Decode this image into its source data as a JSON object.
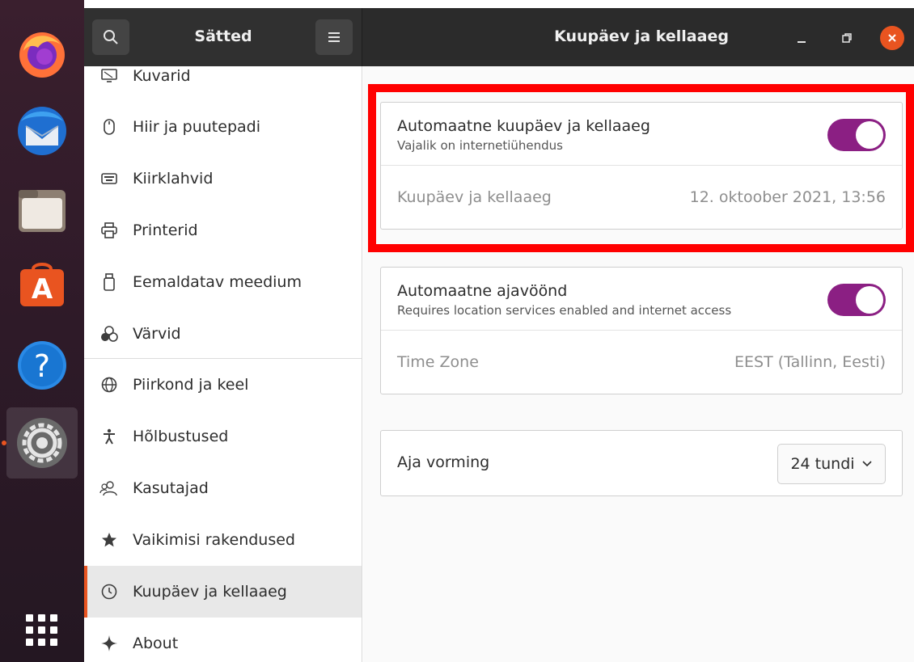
{
  "header": {
    "sidebar_title": "Sätted",
    "panel_title": "Kuupäev ja kellaaeg"
  },
  "dock": {
    "items": [
      {
        "name": "firefox-icon"
      },
      {
        "name": "thunderbird-icon"
      },
      {
        "name": "files-icon"
      },
      {
        "name": "software-icon"
      },
      {
        "name": "help-icon"
      },
      {
        "name": "settings-icon"
      },
      {
        "name": "app-grid-icon"
      }
    ]
  },
  "sidebar": {
    "items": [
      {
        "label": "Kuvarid",
        "icon": "display-icon"
      },
      {
        "label": "Hiir ja puutepadi",
        "icon": "mouse-icon"
      },
      {
        "label": "Kiirklahvid",
        "icon": "keyboard-icon"
      },
      {
        "label": "Printerid",
        "icon": "printer-icon"
      },
      {
        "label": "Eemaldatav meedium",
        "icon": "removable-media-icon"
      },
      {
        "label": "Värvid",
        "icon": "colors-icon"
      },
      {
        "label": "Piirkond ja keel",
        "icon": "globe-icon"
      },
      {
        "label": "Hõlbustused",
        "icon": "accessibility-icon"
      },
      {
        "label": "Kasutajad",
        "icon": "users-icon"
      },
      {
        "label": "Vaikimisi rakendused",
        "icon": "star-icon"
      },
      {
        "label": "Kuupäev ja kellaaeg",
        "icon": "clock-icon",
        "selected": true
      },
      {
        "label": "About",
        "icon": "sparkle-icon"
      }
    ]
  },
  "main": {
    "auto_datetime": {
      "title": "Automaatne kuupäev ja kellaaeg",
      "subtitle": "Vajalik on internetiühendus",
      "enabled": true
    },
    "datetime": {
      "label": "Kuupäev ja kellaaeg",
      "value": "12. oktoober 2021, 13:56"
    },
    "auto_timezone": {
      "title": "Automaatne ajavöönd",
      "subtitle": "Requires location services enabled and internet access",
      "enabled": true
    },
    "timezone": {
      "label": "Time Zone",
      "value": "EEST (Tallinn, Eesti)"
    },
    "time_format": {
      "label": "Aja vorming",
      "value": "24 tundi"
    }
  },
  "colors": {
    "accent": "#e95420",
    "toggle_on": "#8b1f83",
    "highlight": "#ff0000"
  }
}
